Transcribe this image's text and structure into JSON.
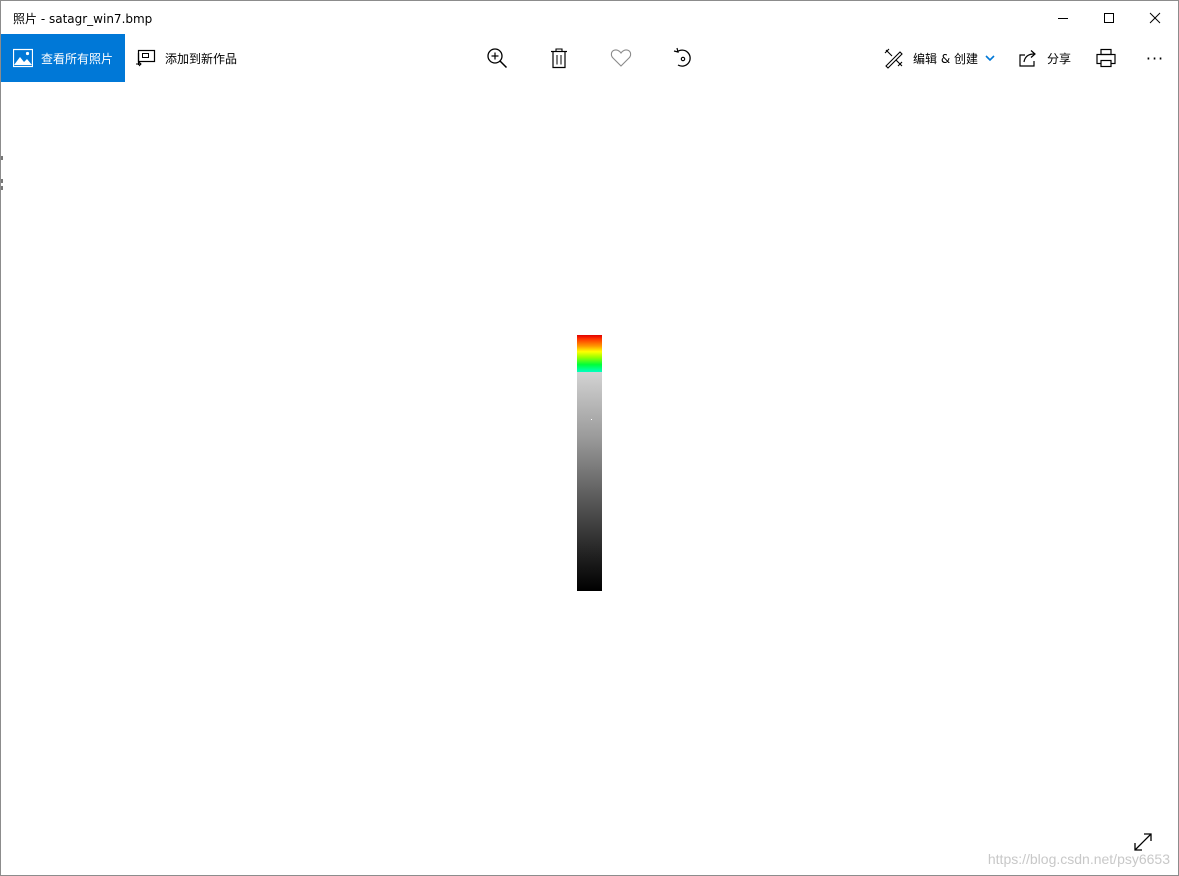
{
  "window": {
    "title": "照片 - satagr_win7.bmp",
    "controls": [
      "minimize",
      "maximize",
      "close"
    ]
  },
  "toolbar": {
    "view_all_label": "查看所有照片",
    "add_to_creation_label": "添加到新作品",
    "zoom_icon": "zoom-in-icon",
    "delete_icon": "trash-icon",
    "favorite_icon": "heart-icon",
    "rotate_icon": "rotate-icon",
    "edit_create_label": "编辑 & 创建",
    "share_label": "分享",
    "print_icon": "printer-icon",
    "more_label": "···"
  },
  "colors": {
    "accent": "#0078d7",
    "chevron": "#0078d7"
  },
  "watermark": "https://blog.csdn.net/psy6653"
}
